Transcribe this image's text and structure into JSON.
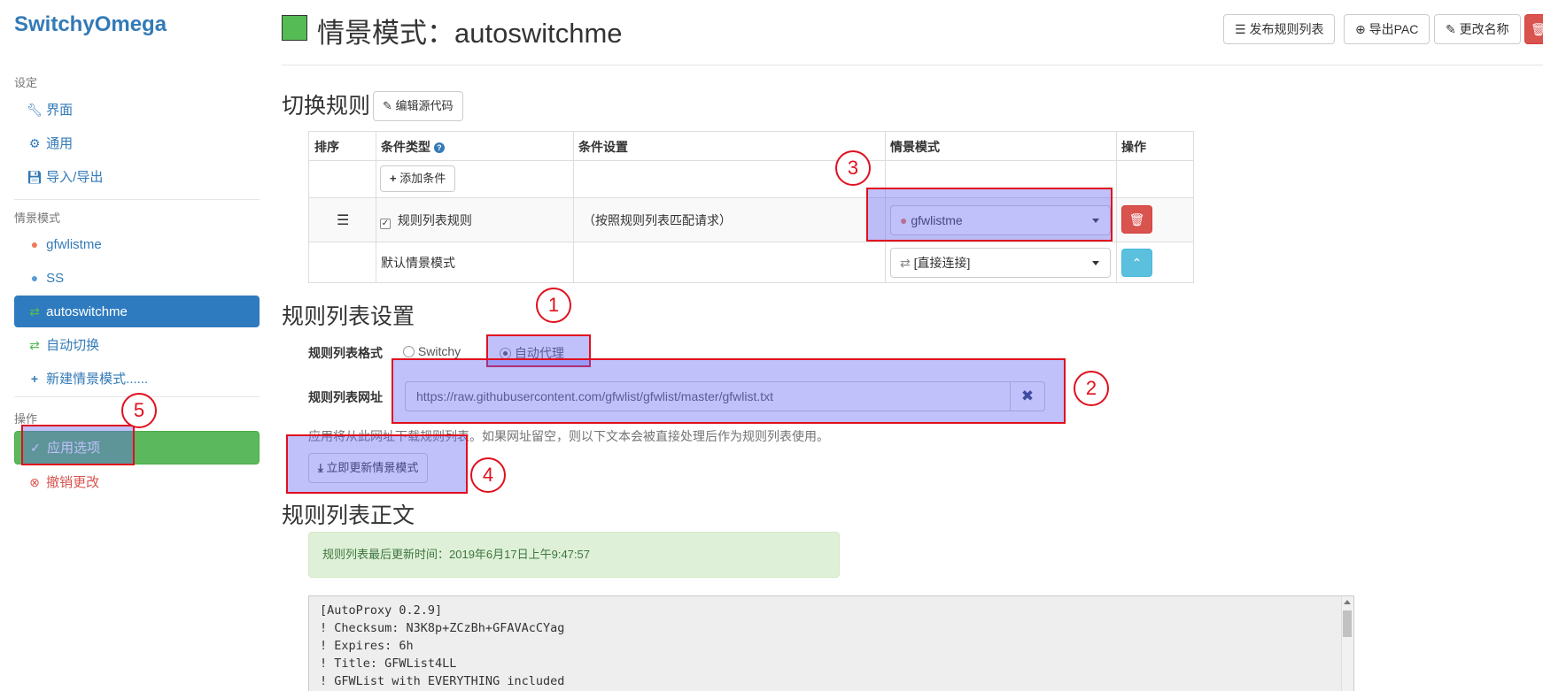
{
  "app": {
    "brand": "SwitchyOmega"
  },
  "sidebar": {
    "settings_heading": "设定",
    "settings_items": [
      {
        "label": "界面",
        "icon": "wrench-icon"
      },
      {
        "label": "通用",
        "icon": "gear-icon"
      },
      {
        "label": "导入/导出",
        "icon": "floppy-icon"
      }
    ],
    "profiles_heading": "情景模式",
    "profile_items": [
      {
        "label": "gfwlistme",
        "icon": "globe-icon",
        "icon_color": "#ee7b5b"
      },
      {
        "label": "SS",
        "icon": "globe-icon",
        "icon_color": "#5b9bd5"
      },
      {
        "label": "autoswitchme",
        "icon": "switch-icon",
        "icon_color": "#55bb55",
        "active": true
      },
      {
        "label": "自动切换",
        "icon": "switch-icon",
        "icon_color": "#55bb55"
      },
      {
        "label": "新建情景模式......",
        "icon": "plus-icon"
      }
    ],
    "actions_heading": "操作",
    "apply_label": "应用选项",
    "discard_label": "撤销更改"
  },
  "header": {
    "title": "情景模式：autoswitchme",
    "color": "#55bb55",
    "buttons": {
      "publish": "发布规则列表",
      "export_pac": "导出PAC",
      "rename": "更改名称"
    }
  },
  "switch_rules": {
    "title": "切换规则",
    "edit_source": "编辑源代码",
    "columns": {
      "order": "排序",
      "condition_type": "条件类型",
      "condition_settings": "条件设置",
      "profile": "情景模式",
      "actions": "操作"
    },
    "add_condition": "添加条件",
    "rule": {
      "type": "规则列表规则",
      "checked": true,
      "details": "（按照规则列表匹配请求）",
      "profile": "gfwlistme"
    },
    "default_row": {
      "label": "默认情景模式",
      "profile": "[直接连接]"
    }
  },
  "rule_list_settings": {
    "title": "规则列表设置",
    "format_label": "规则列表格式",
    "format_options": [
      "Switchy",
      "自动代理"
    ],
    "format_selected": "自动代理",
    "url_label": "规则列表网址",
    "url_value": "https://raw.githubusercontent.com/gfwlist/gfwlist/master/gfwlist.txt",
    "help_text": "应用将从此网址下载规则列表。如果网址留空，则以下文本会被直接处理后作为规则列表使用。",
    "update_button": "立即更新情景模式"
  },
  "rule_list_text": {
    "title": "规则列表正文",
    "last_update": "规则列表最后更新时间：2019年6月17日上午9:47:57",
    "content": "[AutoProxy 0.2.9]\n! Checksum: N3K8p+ZCzBh+GFAVAcCYag\n! Expires: 6h\n! Title: GFWList4LL\n! GFWList with EVERYTHING included"
  },
  "annotations": [
    "1",
    "2",
    "3",
    "4",
    "5"
  ]
}
